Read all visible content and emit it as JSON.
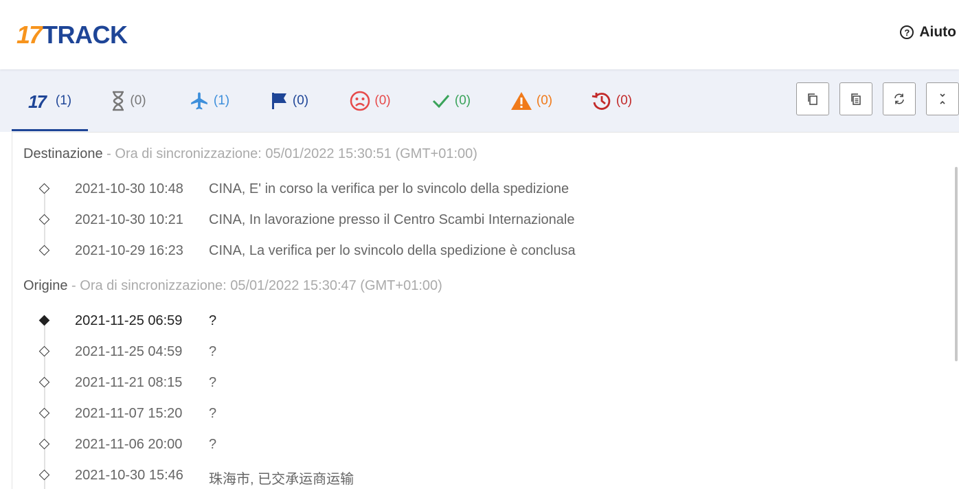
{
  "brand": {
    "num": "17",
    "word": "TRACK",
    "orange": "#f7941d",
    "blue": "#1e4597"
  },
  "help": {
    "label": "Aiuto",
    "icon": "question-circle-icon"
  },
  "tabs": [
    {
      "icon": "17-logo-icon",
      "count": "(1)",
      "color": "#1e4597",
      "active": true
    },
    {
      "icon": "hourglass-icon",
      "count": "(0)",
      "color": "#777777"
    },
    {
      "icon": "airplane-icon",
      "count": "(1)",
      "color": "#3d8fdb"
    },
    {
      "icon": "flag-icon",
      "count": "(0)",
      "color": "#1e4597"
    },
    {
      "icon": "sad-face-icon",
      "count": "(0)",
      "color": "#e64a4a"
    },
    {
      "icon": "checkmark-icon",
      "count": "(0)",
      "color": "#3aa35a"
    },
    {
      "icon": "warning-icon",
      "count": "(0)",
      "color": "#f07a1a"
    },
    {
      "icon": "history-icon",
      "count": "(0)",
      "color": "#c22a2a"
    }
  ],
  "actions": [
    {
      "icon": "copy-icon"
    },
    {
      "icon": "copy-all-icon"
    },
    {
      "icon": "refresh-icon"
    },
    {
      "icon": "collapse-icon"
    }
  ],
  "destination": {
    "name": "Destinazione",
    "sync": " - Ora di sincronizzazione: 05/01/2022 15:30:51 (GMT+01:00)",
    "events": [
      {
        "date": "2021-10-30 10:48",
        "desc": "CINA, E' in corso la verifica per lo svincolo della spedizione"
      },
      {
        "date": "2021-10-30 10:21",
        "desc": "CINA, In lavorazione presso il Centro Scambi Internazionale"
      },
      {
        "date": "2021-10-29 16:23",
        "desc": "CINA, La verifica per lo svincolo della spedizione è conclusa"
      }
    ]
  },
  "origin": {
    "name": "Origine",
    "sync": " - Ora di sincronizzazione: 05/01/2022 15:30:47 (GMT+01:00)",
    "events": [
      {
        "date": "2021-11-25 06:59",
        "desc": "?"
      },
      {
        "date": "2021-11-25 04:59",
        "desc": "?"
      },
      {
        "date": "2021-11-21 08:15",
        "desc": "?"
      },
      {
        "date": "2021-11-07 15:20",
        "desc": "?"
      },
      {
        "date": "2021-11-06 20:00",
        "desc": "?"
      },
      {
        "date": "2021-10-30 15:46",
        "desc": "珠海市, 已交承运商运输"
      }
    ]
  }
}
